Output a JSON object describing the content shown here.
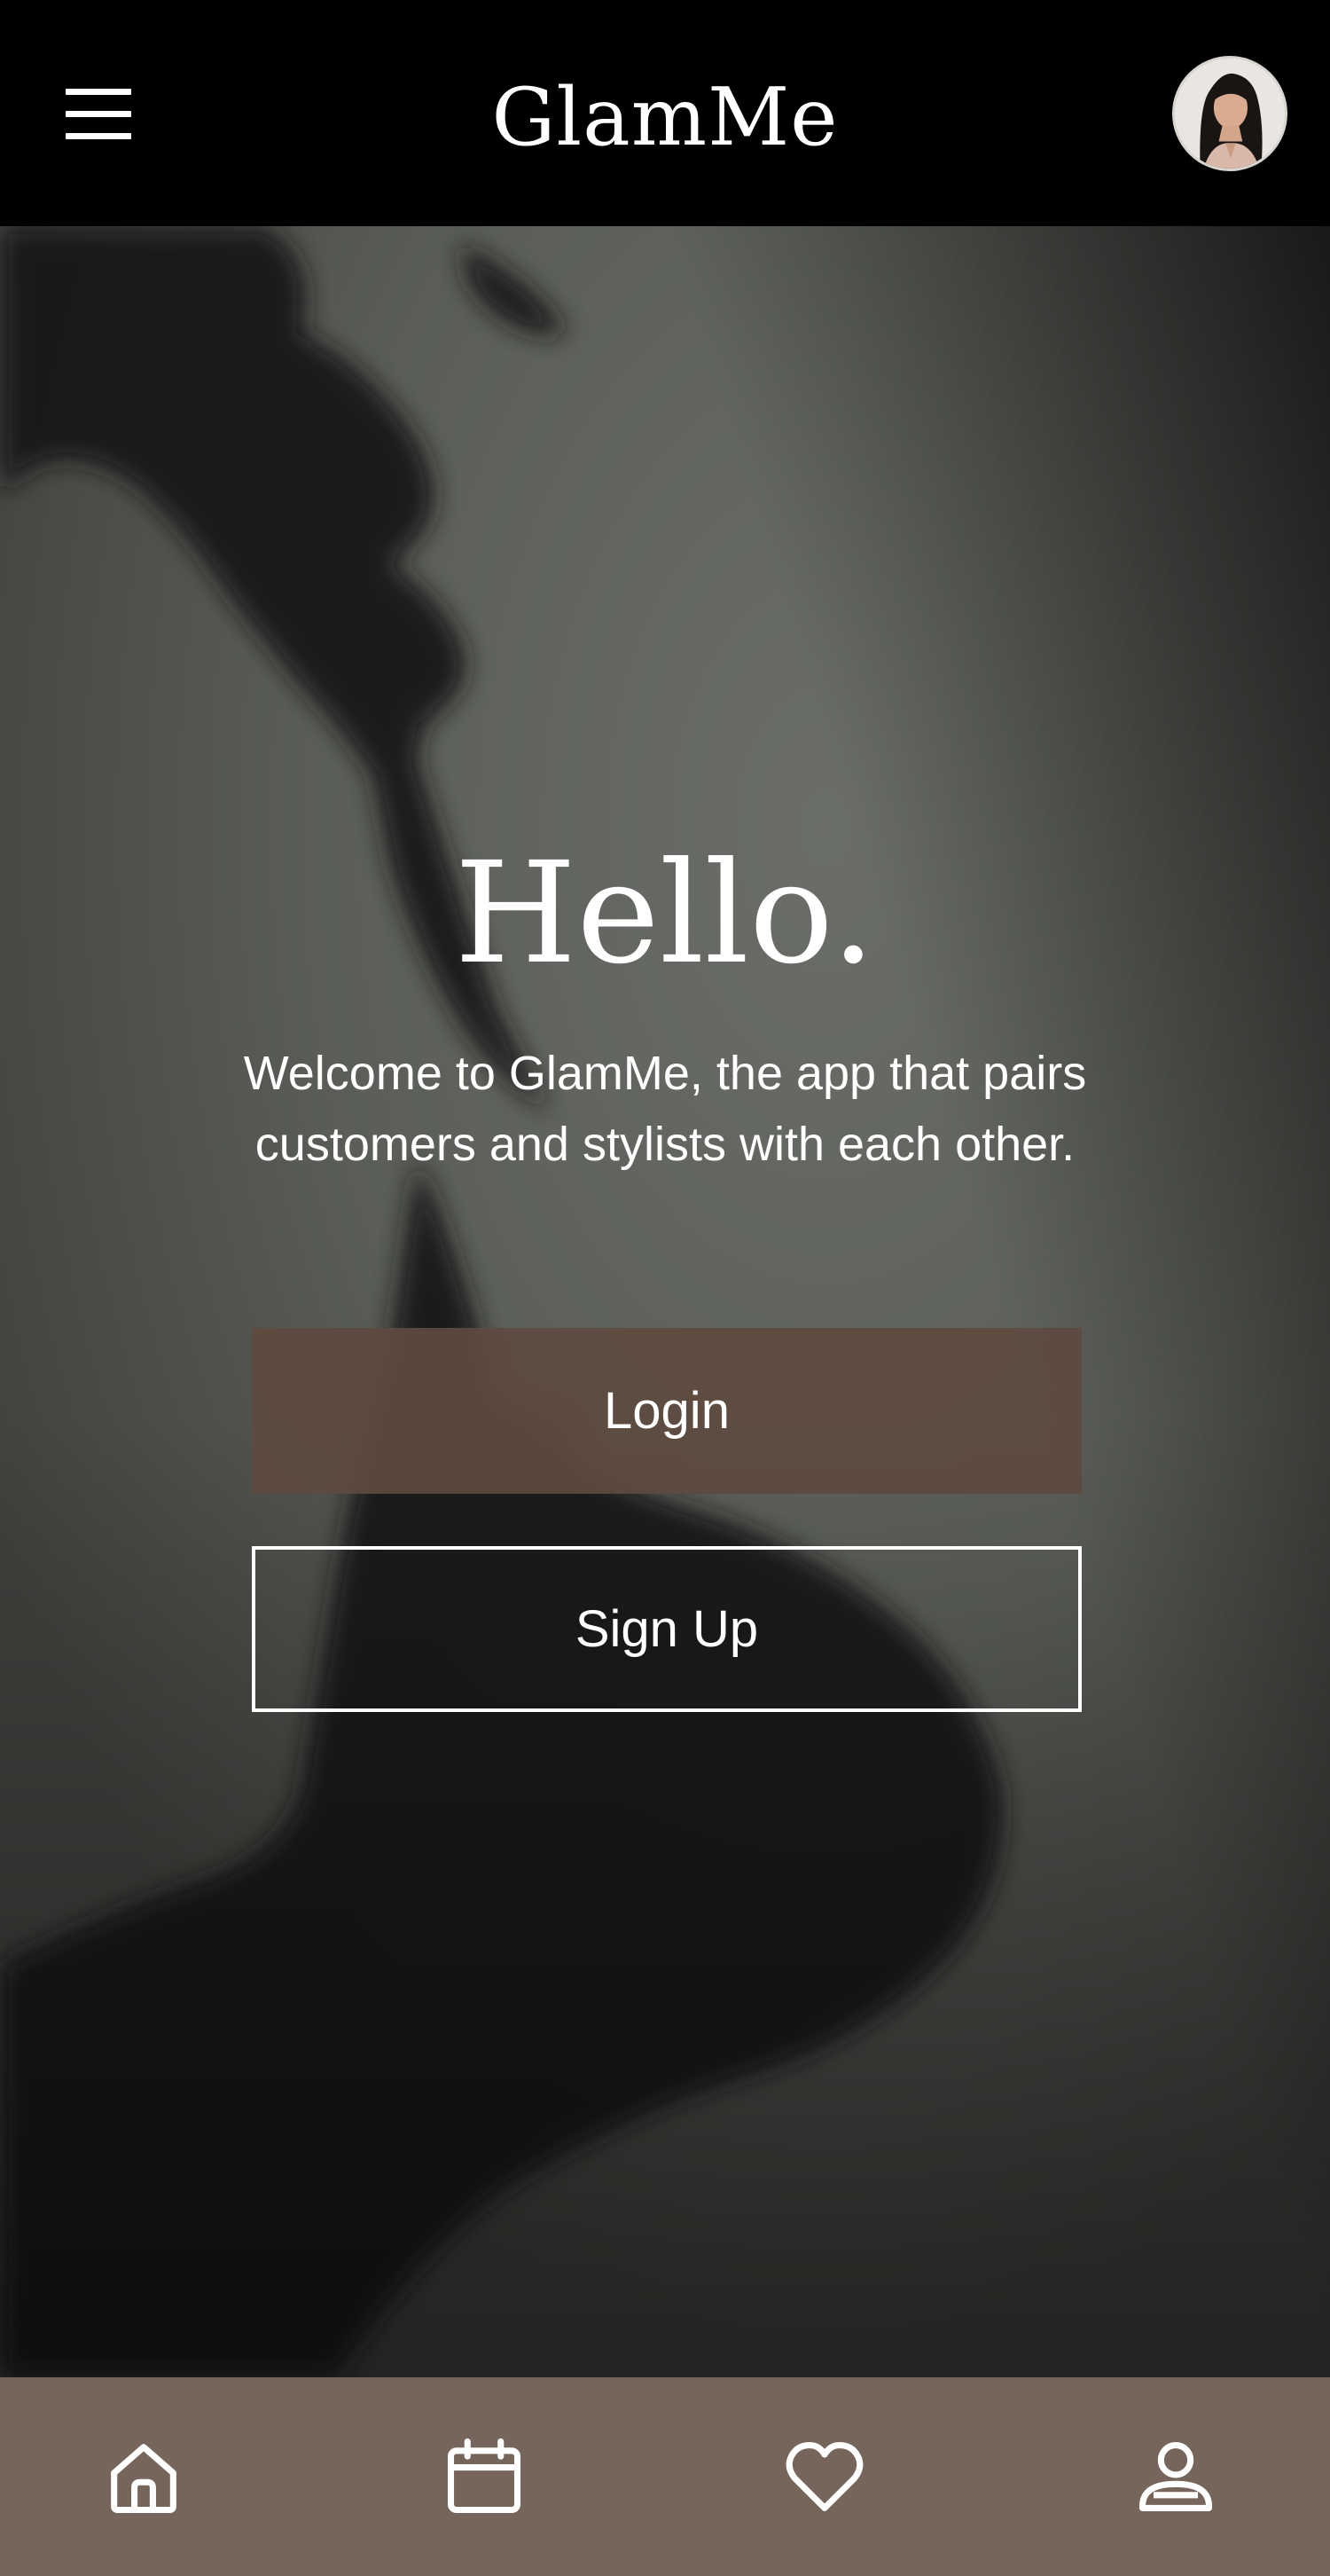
{
  "app": {
    "title": "GlamMe",
    "accent_color": "#5e4a40",
    "nav_color": "#75655a"
  },
  "header": {
    "menu_icon": "menu-icon",
    "avatar_icon": "user-avatar"
  },
  "hero": {
    "heading": "Hello.",
    "welcome_line1": "Welcome to GlamMe, the app that pairs",
    "welcome_line2": "customers and stylists with each other.",
    "login_label": "Login",
    "signup_label": "Sign Up"
  },
  "bottom_nav": {
    "items": [
      {
        "icon": "home-icon"
      },
      {
        "icon": "calendar-icon"
      },
      {
        "icon": "heart-icon"
      },
      {
        "icon": "profile-icon"
      }
    ]
  }
}
